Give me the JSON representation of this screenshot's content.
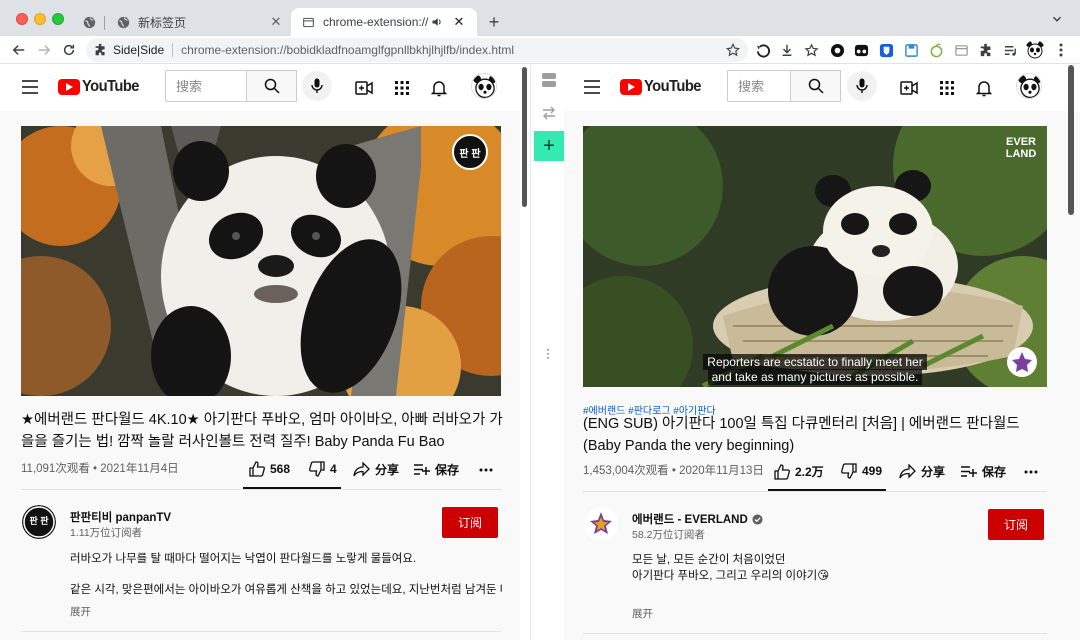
{
  "browser": {
    "tabs": [
      {
        "title": "新标签页"
      },
      {
        "title": "chrome-extension://bobi"
      }
    ],
    "address": {
      "site_name": "Side|Side",
      "url": "chrome-extension://bobidkladfnoamglfgpnllbkhjlhjlfb/index.html"
    }
  },
  "left": {
    "search_placeholder": "搜索",
    "logo_text": "YouTube",
    "title": "★에버랜드 판다월드 4K.10★ 아기판다 푸바오, 엄마 아이바오, 아빠 러바오가 가을을 즐기는 법! 깜짝 놀랄 러사인볼트 전력 질주! Baby Panda Fu Bao",
    "stats": "11,091次观看 • 2021年11月4日",
    "likes": "568",
    "dislikes": "4",
    "share": "分享",
    "save": "保存",
    "channel_name": "판판티비 panpanTV",
    "channel_subs": "1.11万位订阅者",
    "subscribe": "订阅",
    "watermark": "판 판",
    "avatar_text": "판 판",
    "desc_lines": [
      "러바오가 나무를 탈 때마다 떨어지는 낙엽이 판다월드를 노랗게 물들여요.",
      "같은 시각, 맞은편에서는 아이바오가 여유롭게 산책을 하고 있었는데요, 지난번처럼 남겨둔 대나무가 생"
    ],
    "more": "展开"
  },
  "right": {
    "search_placeholder": "搜索",
    "logo_text": "YouTube",
    "hashtags": "#에버랜드 #판다로그 #아기판다",
    "title": "(ENG SUB) 아기판다 100일 특집 다큐멘터리 [처음] | 에버랜드 판다월드 (Baby Panda the very beginning)",
    "stats": "1,453,004次观看 • 2020年11月13日",
    "likes": "2.2万",
    "dislikes": "499",
    "share": "分享",
    "save": "保存",
    "channel_name": "에버랜드 - EVERLAND",
    "channel_subs": "58.2万位订阅者",
    "subscribe": "订阅",
    "watermark": "EVER LAND",
    "captions": [
      "Reporters are ecstatic to finally meet her",
      "and take as many pictures as possible."
    ],
    "desc_lines": [
      "모든 날, 모든 순간이 처음이었던",
      "아기판다 푸바오, 그리고 우리의 이야기😘"
    ],
    "more": "展开"
  },
  "colors": {
    "accent_red": "#cc0000",
    "brand_red": "#ff0000",
    "split_add": "#34eab0"
  }
}
